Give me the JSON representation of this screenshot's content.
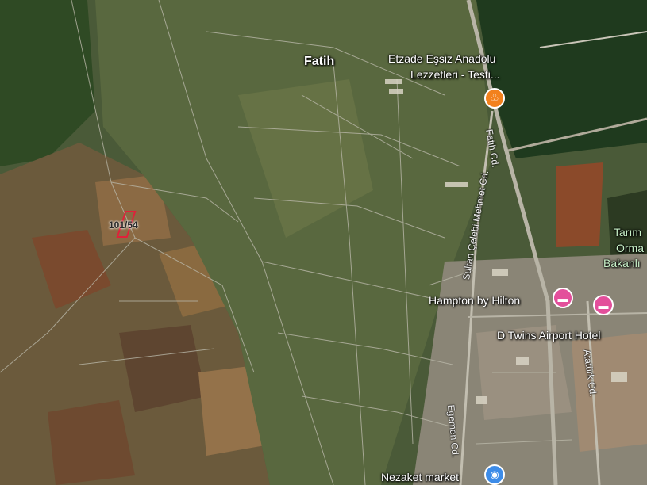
{
  "places": {
    "fatih": "Fatih",
    "etzade_line1": "Etzade Eşsiz Anadolu",
    "etzade_line2": "Lezzetleri - Testi...",
    "hampton": "Hampton by Hilton",
    "d_twins": "D Twins Airport Hotel",
    "tarim_line1": "Tarım",
    "tarim_line2": "Orma",
    "tarim_line3": "Bakanlı",
    "nezaket": "Nezaket market"
  },
  "roads": {
    "fatih_cd": "Fatih Cd.",
    "sultan_celebi": "Sultan Çelebi Mehmet Cd.",
    "ataturk_cd": "Atatürk Cd.",
    "egemen_cd": "Egemen Cd."
  },
  "parcel": {
    "label": "101/54",
    "color": "#e0203a"
  },
  "icons": {
    "restaurant": "fork-knife-icon",
    "hotel": "bed-icon",
    "market": "shopping-bag-icon"
  },
  "colors": {
    "restaurant_pin": "#f2811d",
    "hotel_pin": "#e34f9b",
    "market_pin": "#3d8ce8"
  }
}
